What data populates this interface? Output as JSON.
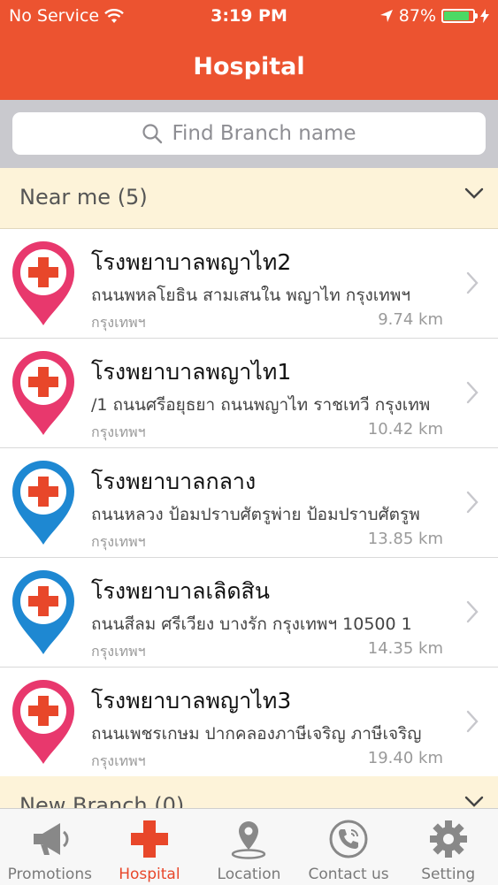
{
  "status_bar": {
    "carrier": "No Service",
    "time": "3:19 PM",
    "battery": "87%",
    "battery_level": 0.87
  },
  "nav": {
    "title": "Hospital"
  },
  "search": {
    "placeholder": "Find Branch name"
  },
  "sections": {
    "near_me": {
      "title": "Near me (5)"
    },
    "new_branch": {
      "title": "New Branch (0)"
    }
  },
  "hospitals": [
    {
      "name": "โรงพยาบาลพญาไท2",
      "address": "ถนนพหลโยธิน สามเสนใน พญาไท กรุงเทพฯ",
      "city": "กรุงเทพฯ",
      "distance": "9.74 km",
      "pin_color": "pink"
    },
    {
      "name": "โรงพยาบาลพญาไท1",
      "address": "/1 ถนนศรีอยุธยา ถนนพญาไท ราชเทวี กรุงเทพ",
      "city": "กรุงเทพฯ",
      "distance": "10.42 km",
      "pin_color": "pink"
    },
    {
      "name": "โรงพยาบาลกลาง",
      "address": "ถนนหลวง ป้อมปราบศัตรูพ่าย ป้อมปราบศัตรูพ",
      "city": "กรุงเทพฯ",
      "distance": "13.85 km",
      "pin_color": "blue"
    },
    {
      "name": "โรงพยาบาลเลิดสิน",
      "address": "ถนนสีลม ศรีเวียง บางรัก กรุงเทพฯ 10500   1",
      "city": "กรุงเทพฯ",
      "distance": "14.35 km",
      "pin_color": "blue"
    },
    {
      "name": "โรงพยาบาลพญาไท3",
      "address": "ถนนเพชรเกษม ปากคลองภาษีเจริญ ภาษีเจริญ",
      "city": "กรุงเทพฯ",
      "distance": "19.40 km",
      "pin_color": "pink"
    }
  ],
  "tabs": [
    {
      "label": "Promotions",
      "icon": "megaphone-icon"
    },
    {
      "label": "Hospital",
      "icon": "red-cross-icon",
      "active": true
    },
    {
      "label": "Location",
      "icon": "map-pin-icon"
    },
    {
      "label": "Contact us",
      "icon": "phone-icon"
    },
    {
      "label": "Setting",
      "icon": "gear-icon"
    }
  ],
  "colors": {
    "header": "#ec5330",
    "pin_pink": "#e8386d",
    "pin_blue": "#1e88d2",
    "cross": "#e8472a",
    "section_bg": "#fdf3d9"
  }
}
